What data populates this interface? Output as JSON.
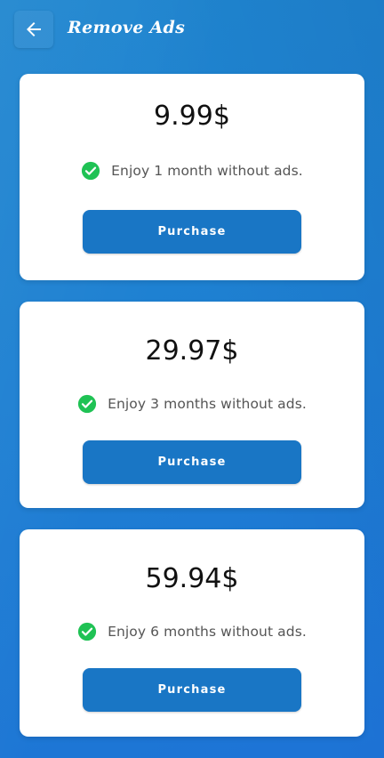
{
  "header": {
    "title": "Remove Ads",
    "back_icon": "arrow-left-icon"
  },
  "plans": [
    {
      "price": "9.99$",
      "feature": "Enjoy 1 month without ads.",
      "button_label": "Purchase"
    },
    {
      "price": "29.97$",
      "feature": "Enjoy 3 months without ads.",
      "button_label": "Purchase"
    },
    {
      "price": "59.94$",
      "feature": "Enjoy 6 months without ads.",
      "button_label": "Purchase"
    }
  ],
  "colors": {
    "background": "#1e80d2",
    "button": "#1976c5",
    "check": "#1fc254",
    "card": "#ffffff"
  },
  "icons": {
    "feature_check": "check-circle-icon"
  }
}
